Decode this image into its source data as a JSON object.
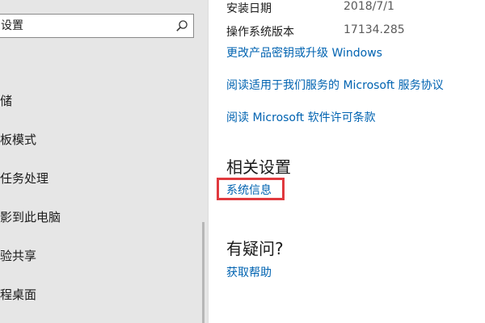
{
  "sidebar": {
    "search": {
      "value": "设置"
    },
    "items": [
      {
        "label": "储"
      },
      {
        "label": "板模式"
      },
      {
        "label": "任务处理"
      },
      {
        "label": "影到此电脑"
      },
      {
        "label": "验共享"
      },
      {
        "label": "程桌面"
      }
    ]
  },
  "main": {
    "install_date": {
      "label": "安装日期",
      "value": "2018/7/1"
    },
    "os_build": {
      "label": "操作系统版本",
      "value": "17134.285"
    },
    "links": {
      "change_key": "更改产品密钥或升级 Windows",
      "service_agreement": "阅读适用于我们服务的 Microsoft 服务协议",
      "license_terms": "阅读 Microsoft 软件许可条款"
    },
    "related_settings": {
      "heading": "相关设置",
      "system_info": "系统信息"
    },
    "questions": {
      "heading": "有疑问?",
      "get_help": "获取帮助"
    }
  },
  "colors": {
    "link": "#0063b1",
    "highlight": "#e0393e",
    "sidebar_bg": "#e6e6e6"
  }
}
